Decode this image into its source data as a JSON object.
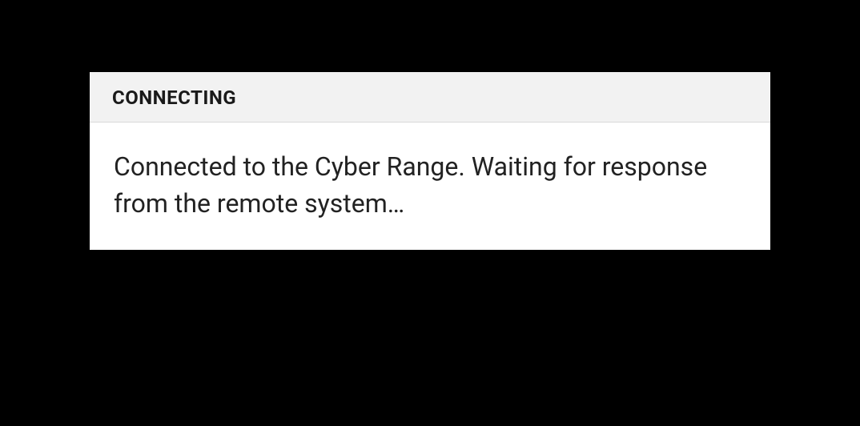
{
  "dialog": {
    "title": "CONNECTING",
    "message": "Connected to the Cyber Range. Waiting for response from the remote system…"
  }
}
